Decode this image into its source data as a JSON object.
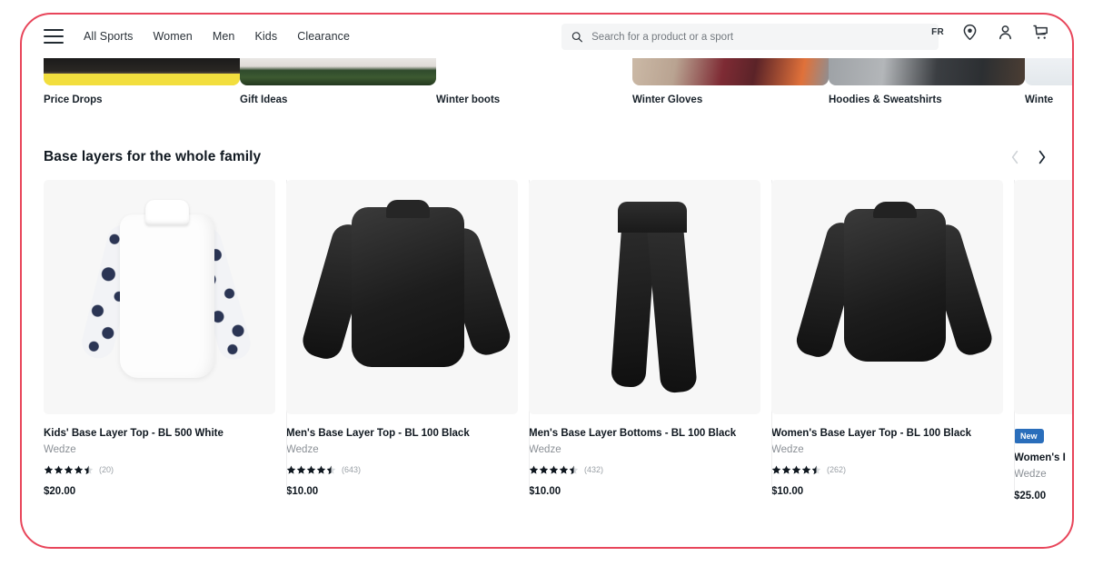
{
  "header": {
    "menu_icon": "hamburger-icon",
    "nav": [
      {
        "label": "All Sports"
      },
      {
        "label": "Women"
      },
      {
        "label": "Men"
      },
      {
        "label": "Kids"
      },
      {
        "label": "Clearance"
      }
    ],
    "search": {
      "icon": "search-icon",
      "placeholder": "Search for a product or a sport",
      "value": ""
    },
    "language": "FR",
    "icons": [
      "location-pin-icon",
      "account-icon",
      "cart-icon"
    ]
  },
  "categories": [
    {
      "label": "Price Drops",
      "thumb": "thumb-pricedrops"
    },
    {
      "label": "Gift Ideas",
      "thumb": "thumb-gift"
    },
    {
      "label": "Winter boots",
      "thumb": "thumb-winterboots"
    },
    {
      "label": "Winter Gloves",
      "thumb": "thumb-gloves"
    },
    {
      "label": "Hoodies & Sweatshirts",
      "thumb": "thumb-hoodies"
    },
    {
      "label": "Winte",
      "thumb": "thumb-winterjackets"
    }
  ],
  "section": {
    "title": "Base layers for the whole family",
    "prev_icon": "chevron-left-icon",
    "next_icon": "chevron-right-icon",
    "prev_enabled": false,
    "next_enabled": true
  },
  "products": [
    {
      "name": "Kids' Base Layer Top - BL 500 White",
      "brand": "Wedze",
      "rating": 4.5,
      "review_count": "(20)",
      "price": "$20.00",
      "badge": null
    },
    {
      "name": "Men's Base Layer Top - BL 100 Black",
      "brand": "Wedze",
      "rating": 4.5,
      "review_count": "(643)",
      "price": "$10.00",
      "badge": null
    },
    {
      "name": "Men's Base Layer Bottoms - BL 100 Black",
      "brand": "Wedze",
      "rating": 4.5,
      "review_count": "(432)",
      "price": "$10.00",
      "badge": null
    },
    {
      "name": "Women's Base Layer Top - BL 100 Black",
      "brand": "Wedze",
      "rating": 4.5,
      "review_count": "(262)",
      "price": "$10.00",
      "badge": null
    },
    {
      "name": "Women's I",
      "brand": "Wedze",
      "rating": null,
      "review_count": "",
      "price": "$25.00",
      "badge": "New"
    }
  ],
  "colors": {
    "frame": "#e8455a",
    "badge_new": "#2a6ebb",
    "text_primary": "#101820",
    "text_muted": "#8b9096",
    "card_bg": "#f7f7f7"
  }
}
